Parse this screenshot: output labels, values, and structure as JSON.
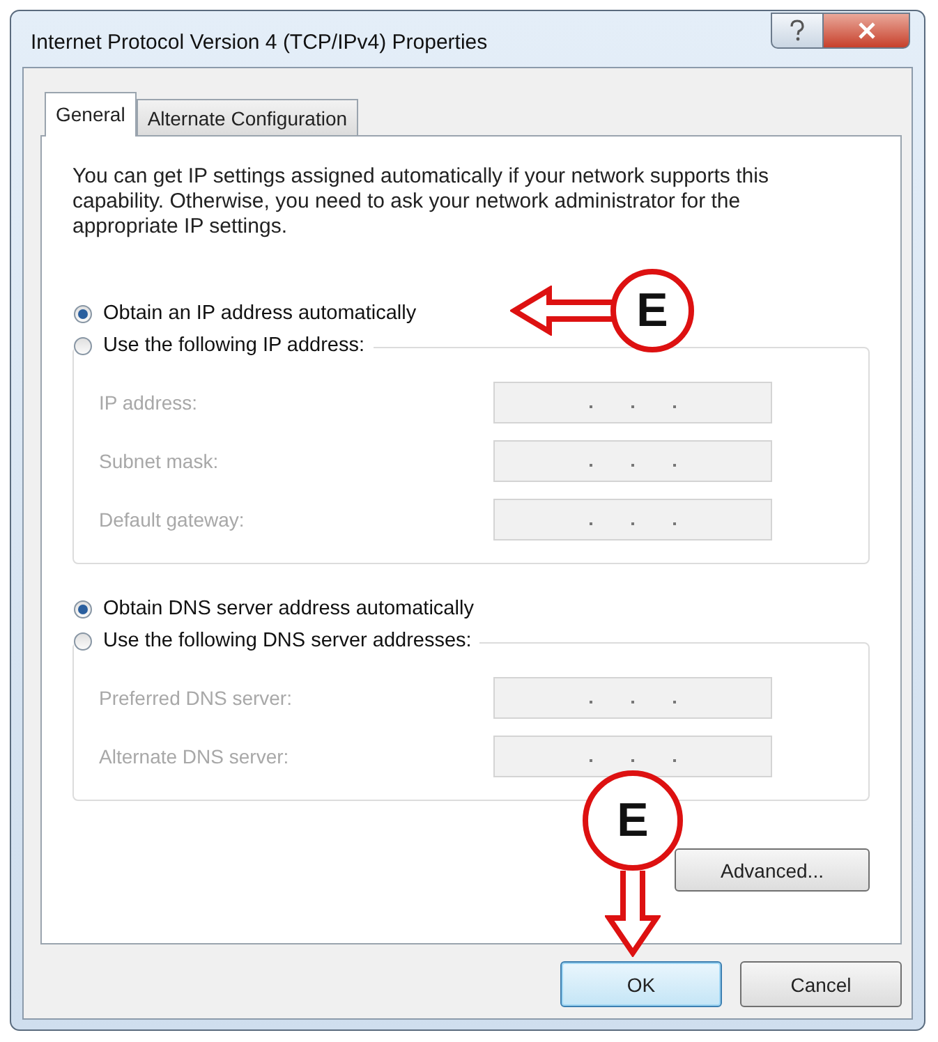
{
  "window": {
    "title": "Internet Protocol Version 4 (TCP/IPv4) Properties"
  },
  "tabs": [
    {
      "label": "General",
      "selected": true
    },
    {
      "label": "Alternate Configuration",
      "selected": false
    }
  ],
  "description": "You can get IP settings assigned automatically if your network supports this capability. Otherwise, you need to ask your network administrator for the appropriate IP settings.",
  "sections": [
    {
      "auto": {
        "label": "Obtain an IP address automatically",
        "selected": true
      },
      "manual": {
        "label": "Use the following IP address:",
        "selected": false
      },
      "fields_disabled": true,
      "fields": [
        {
          "label": "IP address:"
        },
        {
          "label": "Subnet mask:"
        },
        {
          "label": "Default gateway:"
        }
      ]
    },
    {
      "auto": {
        "label": "Obtain DNS server address automatically",
        "selected": true
      },
      "manual": {
        "label": "Use the following DNS server addresses:",
        "selected": false
      },
      "fields_disabled": true,
      "fields": [
        {
          "label": "Preferred DNS server:"
        },
        {
          "label": "Alternate DNS server:"
        }
      ]
    }
  ],
  "advanced_button": "Advanced...",
  "buttons": [
    {
      "label": "OK",
      "default": true
    },
    {
      "label": "Cancel",
      "default": false
    }
  ],
  "callouts": {
    "ip_option": "E",
    "ok_button": "E"
  }
}
